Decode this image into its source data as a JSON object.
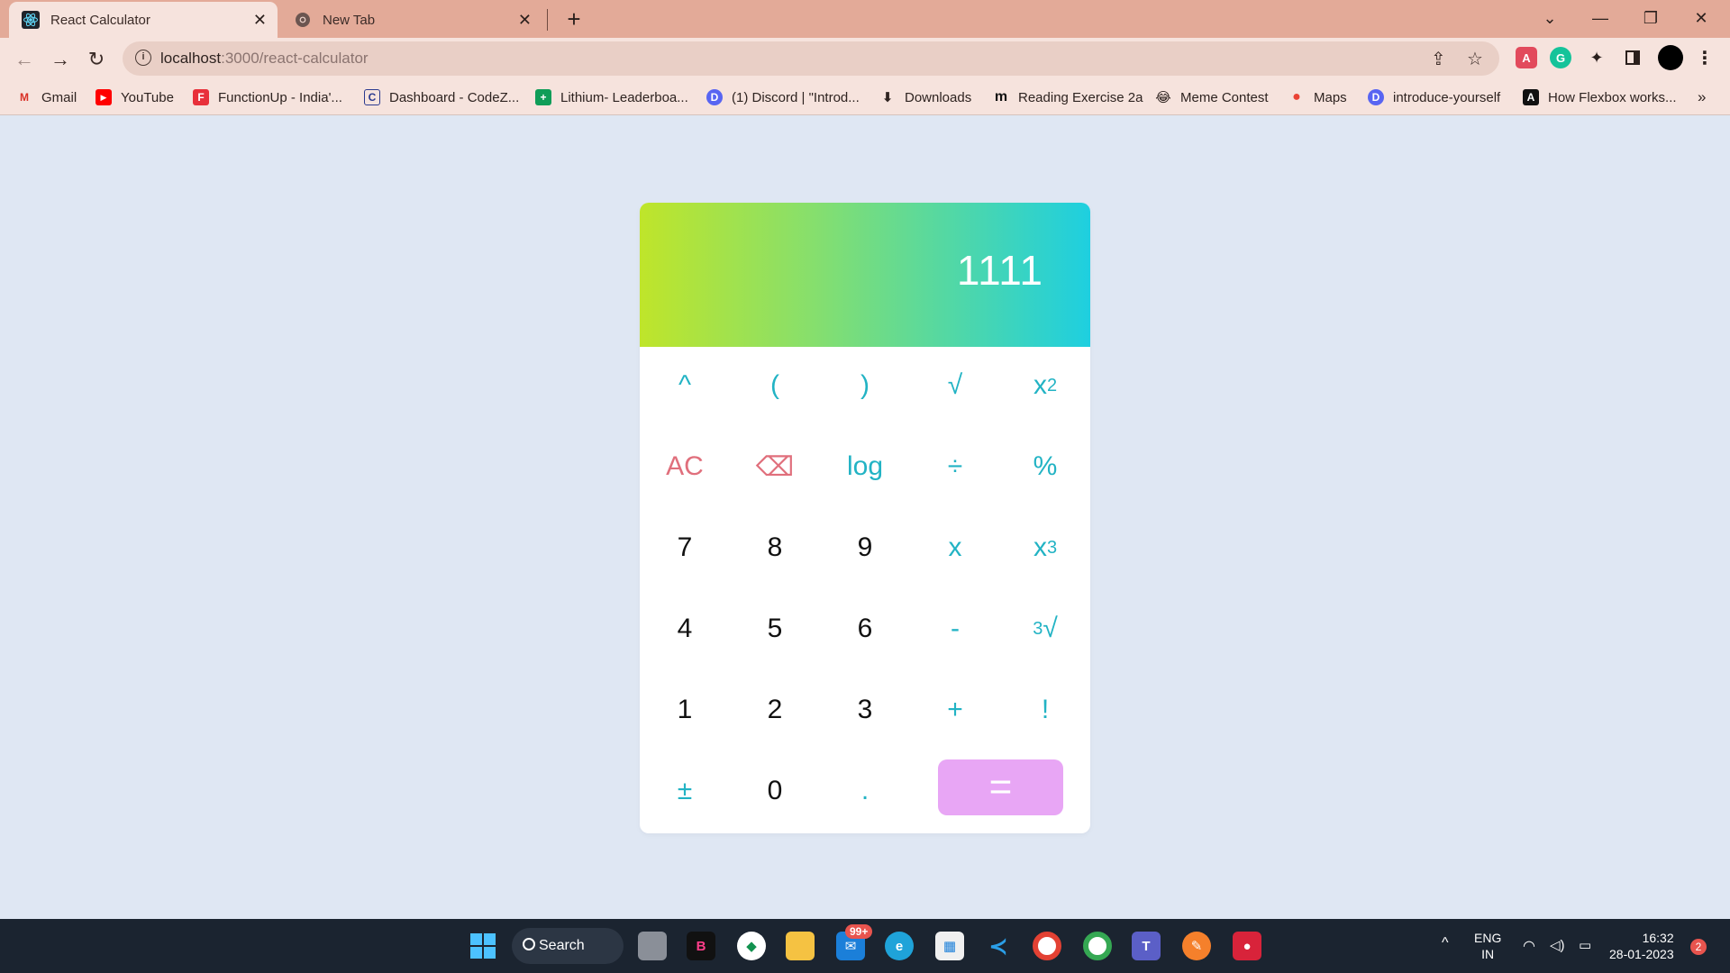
{
  "browser": {
    "tabs": [
      {
        "title": "React Calculator",
        "close": "✕"
      },
      {
        "title": "New Tab",
        "close": "✕"
      }
    ],
    "new_tab": "+",
    "window_controls": {
      "tab_search": "⌄",
      "minimize": "—",
      "restore": "❐",
      "close": "✕"
    },
    "nav": {
      "back": "←",
      "forward": "→",
      "reload": "↻"
    },
    "url_host": "localhost",
    "url_rest": ":3000/react-calculator",
    "info_glyph": "i",
    "omnibox_actions": {
      "share": "⇪",
      "bookmark": "☆"
    },
    "menu": "⋮",
    "bookmarks": [
      {
        "label": "Gmail",
        "icon": "gmail-icon",
        "glyph": "M"
      },
      {
        "label": "YouTube",
        "icon": "youtube-icon",
        "glyph": "▶"
      },
      {
        "label": "FunctionUp - India'...",
        "icon": "functionup-icon",
        "glyph": "F"
      },
      {
        "label": "Dashboard - CodeZ...",
        "icon": "codezinger-icon",
        "glyph": "C"
      },
      {
        "label": "Lithium- Leaderboa...",
        "icon": "sheets-icon",
        "glyph": "+"
      },
      {
        "label": "(1) Discord | \"Introd...",
        "icon": "discord-icon",
        "glyph": "D"
      },
      {
        "label": "Downloads",
        "icon": "download-icon",
        "glyph": "⬇"
      },
      {
        "label": "Reading Exercise 2a",
        "icon": "m-icon",
        "glyph": "m"
      },
      {
        "label": "Meme Contest",
        "icon": "emoji-icon",
        "glyph": "😂"
      },
      {
        "label": "Maps",
        "icon": "maps-icon",
        "glyph": "●"
      },
      {
        "label": "introduce-yourself",
        "icon": "discord-icon",
        "glyph": "D"
      },
      {
        "label": "How Flexbox works...",
        "icon": "flexbox-icon",
        "glyph": "A"
      }
    ],
    "bookmarks_overflow": "»"
  },
  "calculator": {
    "display": "1111",
    "keys": [
      {
        "label": "^",
        "kind": "op"
      },
      {
        "label": "(",
        "kind": "op"
      },
      {
        "label": ")",
        "kind": "op"
      },
      {
        "label": "√",
        "kind": "op"
      },
      {
        "label": "x",
        "sup": "2",
        "kind": "op"
      },
      {
        "label": "AC",
        "kind": "clear"
      },
      {
        "label": "⌫",
        "kind": "clear"
      },
      {
        "label": "log",
        "kind": "op"
      },
      {
        "label": "÷",
        "kind": "op"
      },
      {
        "label": "%",
        "kind": "op"
      },
      {
        "label": "7",
        "kind": "num"
      },
      {
        "label": "8",
        "kind": "num"
      },
      {
        "label": "9",
        "kind": "num"
      },
      {
        "label": "x",
        "kind": "op"
      },
      {
        "label": "x",
        "sup": "3",
        "kind": "op"
      },
      {
        "label": "4",
        "kind": "num"
      },
      {
        "label": "5",
        "kind": "num"
      },
      {
        "label": "6",
        "kind": "num"
      },
      {
        "label": "-",
        "kind": "op"
      },
      {
        "pre": "3",
        "label": "√",
        "kind": "op"
      },
      {
        "label": "1",
        "kind": "num"
      },
      {
        "label": "2",
        "kind": "num"
      },
      {
        "label": "3",
        "kind": "num"
      },
      {
        "label": "+",
        "kind": "op"
      },
      {
        "label": "!",
        "kind": "op"
      },
      {
        "label": "±",
        "kind": "op"
      },
      {
        "label": "0",
        "kind": "num"
      },
      {
        "label": ".",
        "kind": "op"
      }
    ],
    "equals": "="
  },
  "taskbar": {
    "search_label": "Search",
    "badge": "99+",
    "language": "ENG",
    "region": "IN",
    "time": "16:32",
    "date": "28-01-2023",
    "notifications": "2",
    "tray_chevron": "^"
  },
  "colors": {
    "page_bg": "#dfe7f3",
    "accent": "#22b3c4",
    "clear": "#e06f7c",
    "equals": "#e8a6f5",
    "tabbar": "#e3aa98"
  }
}
